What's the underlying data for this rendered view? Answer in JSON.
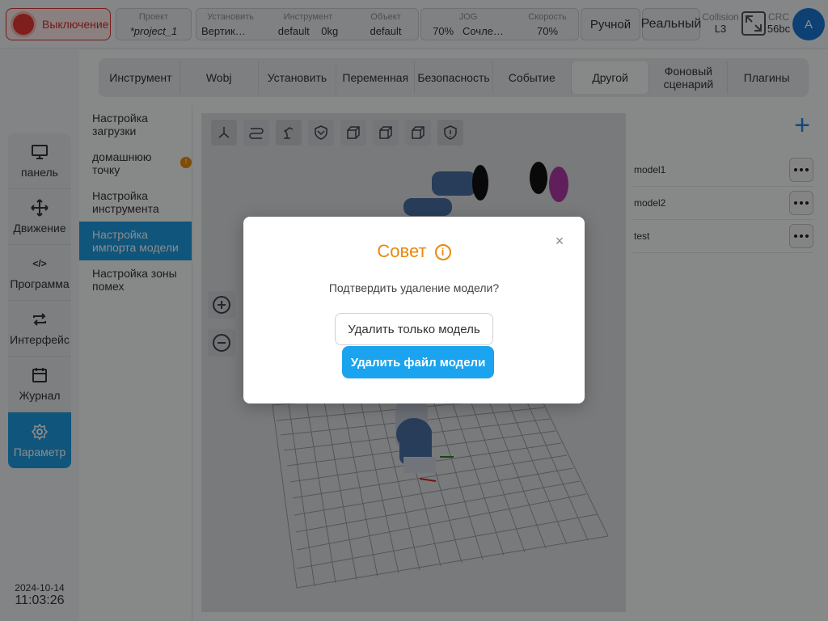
{
  "header": {
    "power_label": "Выключение",
    "project": {
      "label": "Проект",
      "value": "*project_1"
    },
    "install": {
      "label": "Установить",
      "value": "Вертик…"
    },
    "tool": {
      "label": "Инструмент",
      "value": "default",
      "load": "0kg"
    },
    "object": {
      "label": "Объект",
      "value": "default"
    },
    "jog": {
      "label": "JOG",
      "percent": "70%",
      "mode": "Сочле…"
    },
    "speed": {
      "label": "Скорость",
      "value": "70%"
    },
    "manual_label": "Ручной",
    "real_label": "Реальный",
    "collision": {
      "label": "Collision",
      "value": "L3"
    },
    "crc": {
      "label": "CRC",
      "value": "56bc"
    },
    "avatar_letter": "A"
  },
  "leftnav": {
    "items": [
      {
        "label": "панель",
        "icon": "monitor-icon"
      },
      {
        "label": "Движение",
        "icon": "move-icon"
      },
      {
        "label": "Программа",
        "icon": "code-icon"
      },
      {
        "label": "Интерфейс",
        "icon": "swap-icon"
      },
      {
        "label": "Журнал",
        "icon": "calendar-icon"
      },
      {
        "label": "Параметр",
        "icon": "gear-icon",
        "active": true
      }
    ],
    "date": "2024-10-14",
    "time": "11:03:26"
  },
  "tabs": [
    {
      "label": "Инструмент"
    },
    {
      "label": "Wobj"
    },
    {
      "label": "Установить"
    },
    {
      "label": "Переменная"
    },
    {
      "label": "Безопасность"
    },
    {
      "label": "Событие"
    },
    {
      "label": "Другой",
      "active": true
    },
    {
      "label": "Фоновый сценарий"
    },
    {
      "label": "Плагины"
    }
  ],
  "submenu": {
    "items": [
      {
        "label": "Настройка загрузки"
      },
      {
        "label": "домашнюю точку",
        "warning": true
      },
      {
        "label": "Настройка инструмента"
      },
      {
        "label": "Настройка импорта модели",
        "active": true
      },
      {
        "label": "Настройка зоны помех"
      }
    ]
  },
  "models": {
    "items": [
      {
        "name": "model1"
      },
      {
        "name": "model2"
      },
      {
        "name": "test"
      }
    ]
  },
  "dialog": {
    "title": "Совет",
    "info_glyph": "i",
    "close_glyph": "×",
    "message": "Подтвердить удаление модели?",
    "btn_model_only": "Удалить только модель",
    "btn_delete_file": "Удалить файл модели"
  },
  "colors": {
    "accent": "#1e9be0",
    "warning": "#e8890c",
    "danger": "#e53935"
  }
}
